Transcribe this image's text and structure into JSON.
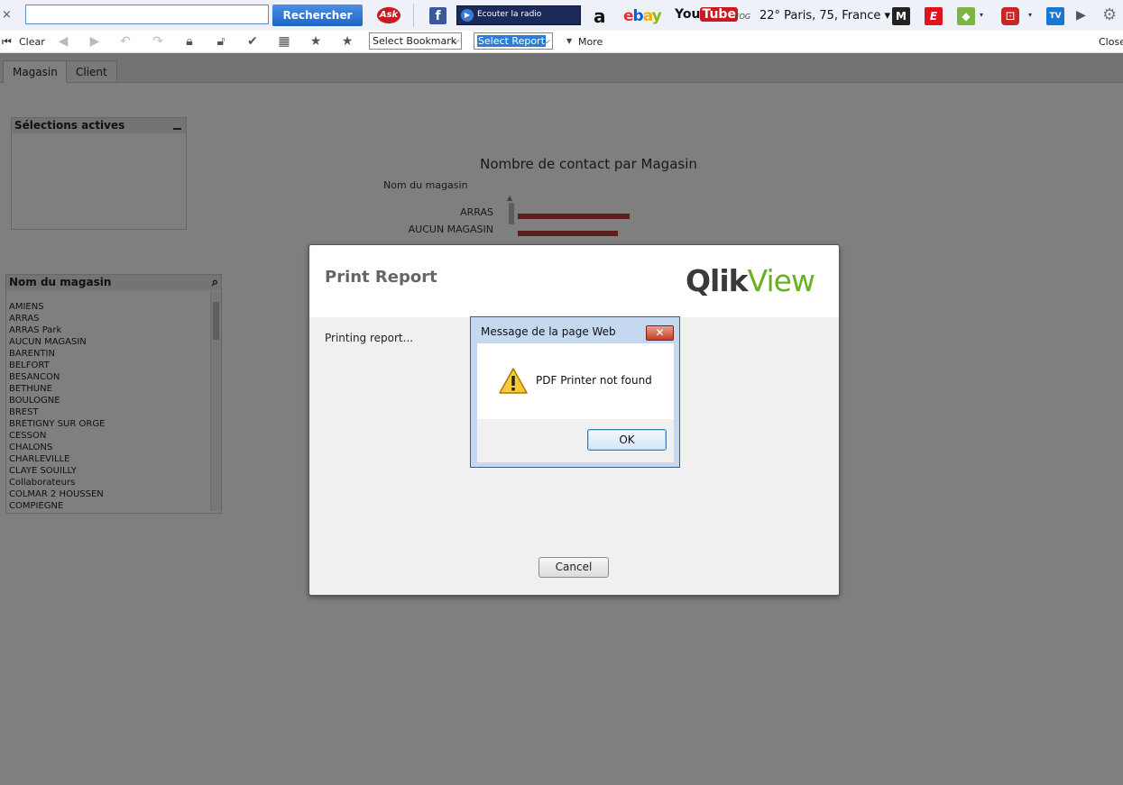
{
  "browser_toolbar": {
    "close_glyph": "×",
    "search_value": "",
    "search_button": "Rechercher",
    "ask_logo": "Ask",
    "facebook_glyph": "f",
    "radio_label": "Ecouter la radio",
    "amazon_glyph": "a",
    "ebay": {
      "e": "e",
      "b": "b",
      "a": "a",
      "y": "y"
    },
    "youtube": {
      "you": "You",
      "tube": "Tube"
    },
    "fog_label": "FOG",
    "weather": "22° Paris, 75, France ▾",
    "icons": [
      "close-icon",
      "ask-icon",
      "facebook-icon",
      "radio-icon",
      "amazon-icon",
      "ebay-icon",
      "youtube-icon",
      "weather-icon",
      "lemonde-icon",
      "lequipe-icon",
      "maps-icon",
      "games-icon",
      "tv-icon",
      "play-icon",
      "settings-icon"
    ]
  },
  "qv_toolbar": {
    "clear": "Clear",
    "select_bookmark": "Select Bookmark",
    "select_report": "Select Report",
    "more": "More",
    "close": "Close"
  },
  "app": {
    "tabs": [
      {
        "label": "Magasin",
        "active": true
      },
      {
        "label": "Client",
        "active": false
      }
    ],
    "active_selections": {
      "title": "Sélections actives"
    },
    "listbox": {
      "title": "Nom du magasin",
      "items": [
        "AMIENS",
        "ARRAS",
        "ARRAS Park",
        "AUCUN MAGASIN",
        "BARENTIN",
        "BELFORT",
        "BESANCON",
        "BETHUNE",
        "BOULOGNE",
        "BREST",
        "BRETIGNY SUR ORGE",
        "CESSON",
        "CHALONS",
        "CHARLEVILLE",
        "CLAYE SOUILLY",
        "Collaborateurs",
        "COLMAR 2   HOUSSEN",
        "COMPIEGNE"
      ]
    }
  },
  "chart_data": {
    "type": "bar",
    "title": "Nombre de contact par Magasin",
    "ylabel": "Nom du magasin",
    "categories": [
      "ARRAS",
      "AUCUN MAGASIN"
    ],
    "values": [
      124,
      111
    ],
    "orientation": "horizontal",
    "colors": {
      "bar": "#b83b3b"
    }
  },
  "print_dialog": {
    "title": "Print Report",
    "logo": {
      "qlik": "Qlik",
      "view": "View"
    },
    "status": "Printing report...",
    "cancel": "Cancel"
  },
  "message_box": {
    "title": "Message de la page Web",
    "close_glyph": "✕",
    "text": "PDF Printer not found",
    "ok": "OK"
  }
}
